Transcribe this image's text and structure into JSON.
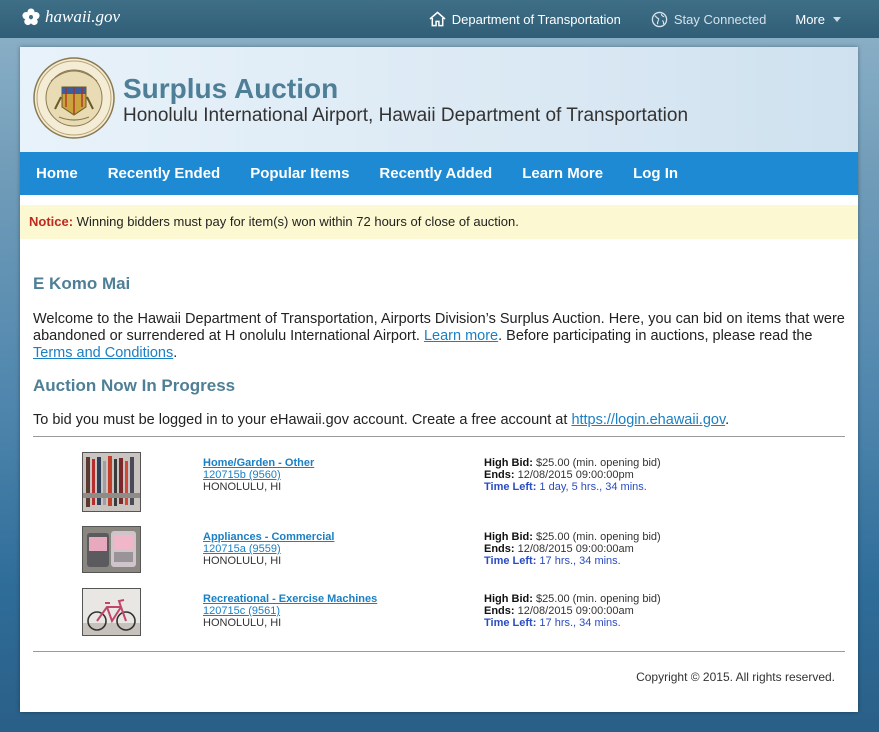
{
  "topbar": {
    "logo_text": "hawaii.gov",
    "nav": [
      {
        "label": "Department of Transportation",
        "icon": "home-icon"
      },
      {
        "label": "Stay Connected",
        "icon": "globe-icon"
      },
      {
        "label": "More",
        "icon": "chevron-down-icon"
      }
    ]
  },
  "header": {
    "title": "Surplus Auction",
    "subtitle": "Honolulu International Airport, Hawaii Department of Transportation"
  },
  "mainnav": [
    "Home",
    "Recently Ended",
    "Popular Items",
    "Recently Added",
    "Learn More",
    "Log In"
  ],
  "notice": {
    "label": "Notice:",
    "text": " Winning bidders must pay for item(s) won within 72 hours of close of auction."
  },
  "welcome": {
    "heading": "E Komo Mai",
    "text1": "Welcome to the Hawaii Department of Transportation, Airports Division’s Surplus Auction. Here, you can bid on items that were abandoned or surrendered at H onolulu International Airport. ",
    "link1": "Learn more",
    "text2": ". Before participating in auctions, please read the ",
    "link2": "Terms and Conditions",
    "text3": "."
  },
  "auction": {
    "heading": "Auction Now In Progress",
    "text": "To bid you must be logged in to your eHawaii.gov account. Create a free account at ",
    "link": "https://login.ehawaii.gov",
    "text_end": "."
  },
  "items": [
    {
      "category": "Home/Garden - Other ",
      "id": "120715b (9560) ",
      "location": "HONOLULU, HI",
      "high_bid_label": "High Bid:",
      "high_bid": " $25.00 (min. opening bid)",
      "ends_label": "Ends:",
      "ends": " 12/08/2015 09:00:00pm",
      "time_left_label": "Time Left:",
      "time_left": " 1 day, 5 hrs., 34 mins."
    },
    {
      "category": "Appliances - Commercial ",
      "id": "120715a (9559) ",
      "location": "HONOLULU, HI",
      "high_bid_label": "High Bid:",
      "high_bid": " $25.00 (min. opening bid)",
      "ends_label": "Ends:",
      "ends": " 12/08/2015 09:00:00am",
      "time_left_label": "Time Left:",
      "time_left": " 17 hrs., 34 mins."
    },
    {
      "category": "Recreational - Exercise Machines ",
      "id": "120715c (9561) ",
      "location": "HONOLULU, HI",
      "high_bid_label": "High Bid:",
      "high_bid": " $25.00 (min. opening bid)",
      "ends_label": "Ends:",
      "ends": " 12/08/2015 09:00:00am",
      "time_left_label": "Time Left:",
      "time_left": " 17 hrs., 34 mins."
    }
  ],
  "footer": {
    "copyright": "Copyright © 2015. All rights reserved."
  },
  "colors": {
    "nav_blue": "#1d8ad3",
    "title_teal": "#4e7f96",
    "link_blue": "#1b7fc3",
    "notice_red": "#c0291f",
    "notice_bg": "#fcf9d2"
  }
}
